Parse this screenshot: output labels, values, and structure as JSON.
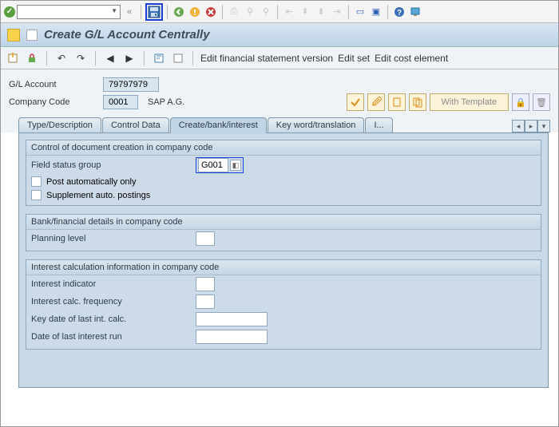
{
  "title": "Create G/L Account Centrally",
  "toolbar2": {
    "edit_fsv": "Edit financial statement version",
    "edit_set": "Edit set",
    "edit_cost": "Edit cost element"
  },
  "header": {
    "gl_label": "G/L Account",
    "gl_value": "79797979",
    "cc_label": "Company Code",
    "cc_value": "0001",
    "cc_text": "SAP A.G.",
    "with_template": "With Template"
  },
  "tabs": {
    "t1": "Type/Description",
    "t2": "Control Data",
    "t3": "Create/bank/interest",
    "t4": "Key word/translation",
    "t5": "I..."
  },
  "group1": {
    "title": "Control of document creation in company code",
    "field_status_label": "Field status group",
    "field_status_value": "G001",
    "post_auto": "Post automatically only",
    "supp_auto": "Supplement auto. postings"
  },
  "group2": {
    "title": "Bank/financial details in company code",
    "planning_label": "Planning level"
  },
  "group3": {
    "title": "Interest calculation information in company code",
    "ind_label": "Interest indicator",
    "freq_label": "Interest calc. frequency",
    "keydate_label": "Key date of last int. calc.",
    "lastrun_label": "Date of last interest run"
  }
}
